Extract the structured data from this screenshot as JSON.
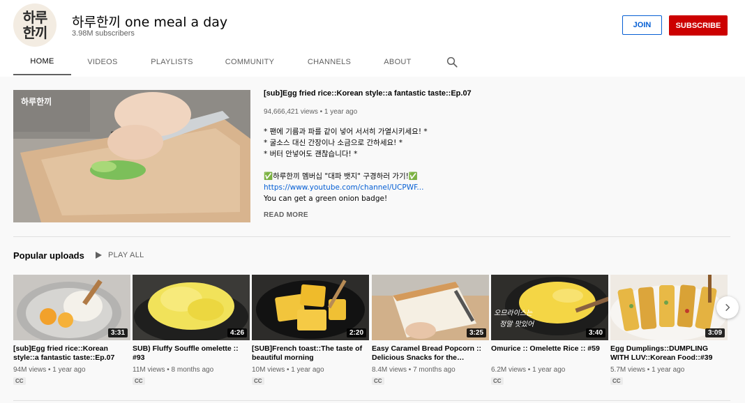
{
  "channel": {
    "avatar_line1": "하루",
    "avatar_line2": "한끼",
    "name": "하루한끼 one meal a day",
    "subscribers": "3.98M subscribers",
    "join_label": "JOIN",
    "subscribe_label": "SUBSCRIBE"
  },
  "tabs": [
    {
      "label": "HOME",
      "active": true
    },
    {
      "label": "VIDEOS"
    },
    {
      "label": "PLAYLISTS"
    },
    {
      "label": "COMMUNITY"
    },
    {
      "label": "CHANNELS"
    },
    {
      "label": "ABOUT"
    }
  ],
  "featured": {
    "watermark": "하루한끼",
    "title": "[sub]Egg fried rice::Korean style::a fantastic taste::Ep.07",
    "meta": "94,666,421 views • 1 year ago",
    "desc_lines": [
      "* 팬에 기름과 파를 같이 넣어 서서히 가열시키세요! *",
      "* 굴소스 대신 간장이나 소금으로 간하세요! *",
      "* 버터 안넣어도 괜찮습니다! *",
      "",
      "✅하루한끼 멤버십 \"대파 뱃지\" 구경하러 가기!✅",
      "https://www.youtube.com/channel/UCPWF...",
      "You can get a green onion badge!"
    ],
    "read_more": "READ MORE"
  },
  "section": {
    "title": "Popular uploads",
    "play_all": "PLAY ALL"
  },
  "videos": [
    {
      "title": "[sub]Egg fried rice::Korean style::a fantastic taste::Ep.07",
      "meta": "94M views • 1 year ago",
      "duration": "3:31",
      "cc": "CC"
    },
    {
      "title": "SUB) Fluffy Souffle omelette :: #93",
      "meta": "11M views • 8 months ago",
      "duration": "4:26",
      "cc": "CC"
    },
    {
      "title": "[SUB]French toast::The taste of beautiful morning",
      "meta": "10M views • 1 year ago",
      "duration": "2:20",
      "cc": "CC"
    },
    {
      "title": "Easy Caramel Bread Popcorn :: Delicious Snacks for the…",
      "meta": "8.4M views • 7 months ago",
      "duration": "3:25",
      "cc": "CC"
    },
    {
      "title": "Omurice :: Omelette Rice :: #59",
      "meta": "6.2M views • 1 year ago",
      "duration": "3:40",
      "cc": "CC",
      "thumb_text1": "오므라이스는",
      "thumb_text2": "정말 맛있어"
    },
    {
      "title": "Egg Dumplings::DUMPLING WITH LUV::Korean Food::#39",
      "meta": "5.7M views • 1 year ago",
      "duration": "3:09",
      "cc": "CC"
    }
  ]
}
